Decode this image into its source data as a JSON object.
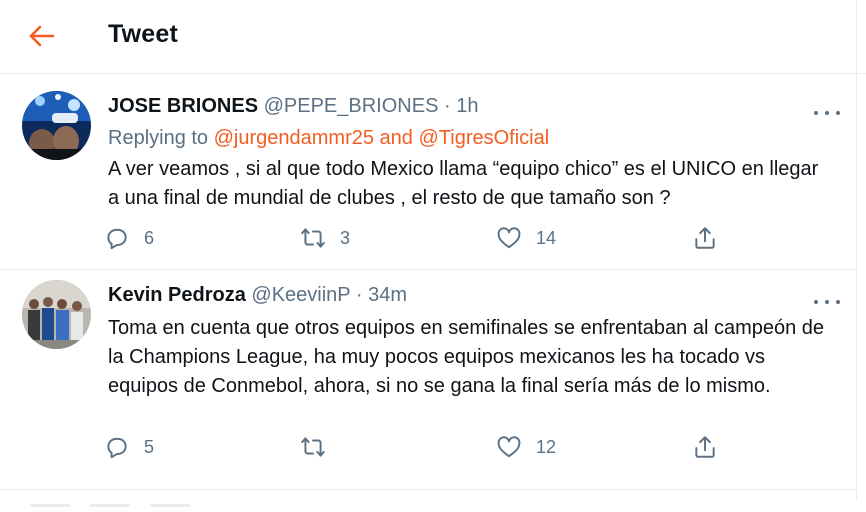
{
  "header": {
    "title": "Tweet",
    "accent": "#f45d22"
  },
  "tweets": [
    {
      "name": "JOSE BRIONES",
      "handle": "@PEPE_BRIONES",
      "separator": "·",
      "time": "1h",
      "reply_prefix": "Replying to",
      "reply_mentions": "@jurgendammr25 and @TigresOficial",
      "text": "A ver veamos , si al que todo Mexico llama “equipo chico” es el UNICO en llegar a una final de mundial de clubes , el resto de que tamaño son ?",
      "replies": "6",
      "retweets": "3",
      "likes": "14"
    },
    {
      "name": "Kevin Pedroza",
      "handle": "@KeeviinP",
      "separator": "·",
      "time": "34m",
      "text": "Toma en cuenta que otros equipos en semifinales se enfrentaban al campeón de la Champions League, ha muy pocos equipos mexicanos les ha tocado vs equipos de Conmebol, ahora, si no se gana la final sería más de lo mismo.",
      "replies": "5",
      "retweets": "",
      "likes": "12"
    }
  ],
  "icons": [
    "back-arrow-icon",
    "more-icon",
    "reply-icon",
    "retweet-icon",
    "like-icon",
    "share-icon"
  ]
}
